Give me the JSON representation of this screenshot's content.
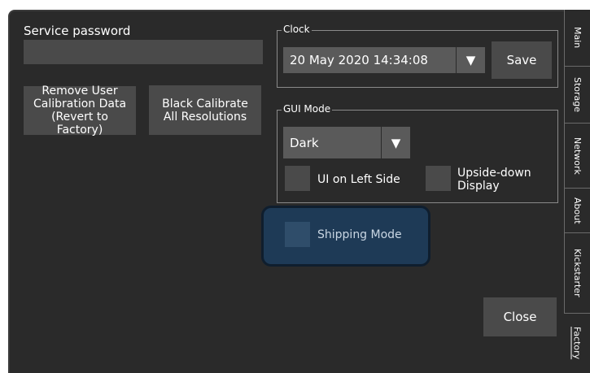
{
  "service": {
    "password_label": "Service password",
    "password_value": ""
  },
  "buttons": {
    "remove_calibration": "Remove User Calibration Data (Revert to Factory)",
    "black_calibrate": "Black Calibrate All Resolutions",
    "save": "Save",
    "close": "Close"
  },
  "clock": {
    "title": "Clock",
    "value": "20 May 2020 14:34:08",
    "arrow": "▼"
  },
  "gui_mode": {
    "title": "GUI Mode",
    "selected": "Dark",
    "arrow": "▼",
    "ui_left_label": "UI on Left Side",
    "upside_down_label": "Upside-down Display"
  },
  "shipping": {
    "label": "Shipping Mode",
    "highlight_color": "#1e3a56"
  },
  "tabs": [
    {
      "label": "Main"
    },
    {
      "label": "Storage"
    },
    {
      "label": "Network"
    },
    {
      "label": "About"
    },
    {
      "label": "Kickstarter"
    },
    {
      "label": "Factory",
      "active": true
    }
  ]
}
